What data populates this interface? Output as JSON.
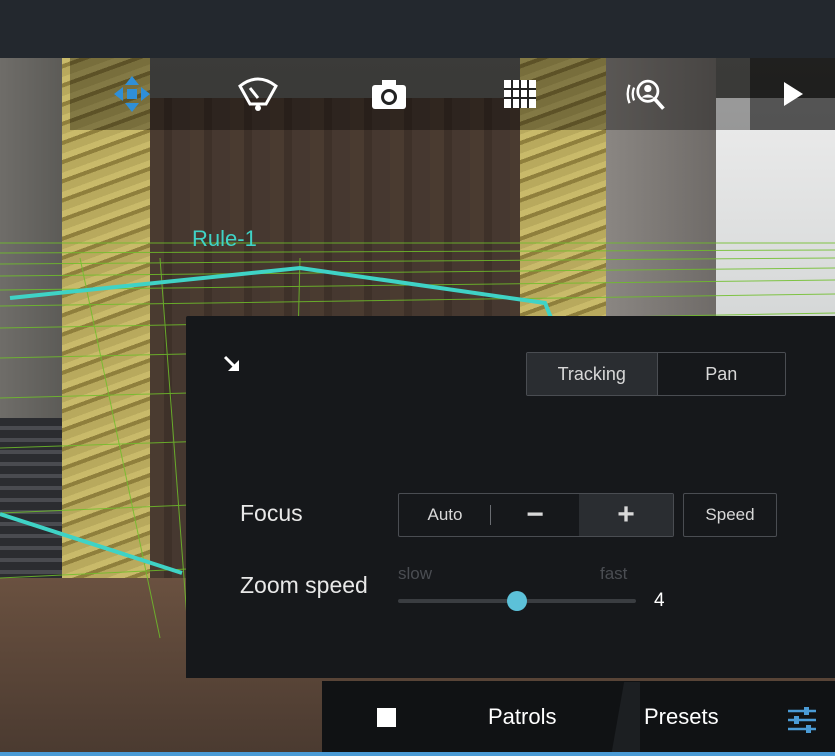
{
  "toolbar": {
    "icons": [
      "ptz-move-icon",
      "speedometer-icon",
      "camera-snapshot-icon",
      "grid-icon",
      "voice-search-icon",
      "play-icon"
    ]
  },
  "scene": {
    "rule_label": "Rule-1"
  },
  "panel": {
    "mode_segment": {
      "tracking_label": "Tracking",
      "pan_label": "Pan",
      "selected": "Tracking"
    },
    "focus": {
      "label": "Focus",
      "auto_label": "Auto",
      "minus_label": "−",
      "plus_label": "+",
      "speed_label": "Speed"
    },
    "zoom_speed": {
      "label": "Zoom speed",
      "slow_label": "slow",
      "fast_label": "fast",
      "value": "4",
      "level_fraction": 0.5
    }
  },
  "bottom_bar": {
    "patrols_label": "Patrols",
    "presets_label": "Presets"
  },
  "colors": {
    "accent": "#5cc1d9",
    "rule_line": "#3fd3c6",
    "grid_line": "#6fbf2a",
    "panel_bg": "#16181b",
    "selection_bar": "#4a9bd6"
  }
}
